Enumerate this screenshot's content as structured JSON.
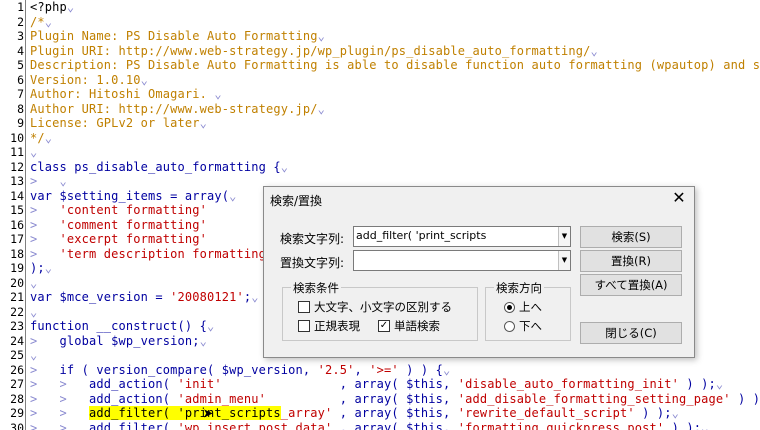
{
  "editor": {
    "lines": [
      {
        "n": "1",
        "segs": [
          {
            "t": "<?php",
            "c": ""
          },
          {
            "t": "⌄",
            "c": "mark"
          }
        ]
      },
      {
        "n": "2",
        "segs": [
          {
            "t": "/*",
            "c": "cmt"
          },
          {
            "t": "⌄",
            "c": "mark"
          }
        ]
      },
      {
        "n": "3",
        "segs": [
          {
            "t": "Plugin Name: PS Disable Auto Formatting",
            "c": "cmt"
          },
          {
            "t": "⌄",
            "c": "mark"
          }
        ]
      },
      {
        "n": "4",
        "segs": [
          {
            "t": "Plugin URI: http://www.web-strategy.jp/wp_plugin/ps_disable_auto_formatting/",
            "c": "cmt"
          },
          {
            "t": "⌄",
            "c": "mark"
          }
        ]
      },
      {
        "n": "5",
        "segs": [
          {
            "t": "Description: PS Disable Auto Formatting is able to disable function auto formatting (wpautop) and save &",
            "c": "cmt"
          }
        ]
      },
      {
        "n": "6",
        "segs": [
          {
            "t": "Version: 1.0.10",
            "c": "cmt"
          },
          {
            "t": "⌄",
            "c": "mark"
          }
        ]
      },
      {
        "n": "7",
        "segs": [
          {
            "t": "Author: Hitoshi Omagari.",
            "c": "cmt"
          },
          {
            "t": " ⌄",
            "c": "mark"
          }
        ]
      },
      {
        "n": "8",
        "segs": [
          {
            "t": "Author URI: http://www.web-strategy.jp/",
            "c": "cmt"
          },
          {
            "t": "⌄",
            "c": "mark"
          }
        ]
      },
      {
        "n": "9",
        "segs": [
          {
            "t": "License: GPLv2 or later",
            "c": "cmt"
          },
          {
            "t": "⌄",
            "c": "mark"
          }
        ]
      },
      {
        "n": "10",
        "segs": [
          {
            "t": "*/",
            "c": "cmt"
          },
          {
            "t": "⌄",
            "c": "mark"
          }
        ]
      },
      {
        "n": "11",
        "segs": [
          {
            "t": "⌄",
            "c": "mark"
          }
        ]
      },
      {
        "n": "12",
        "segs": [
          {
            "t": "class",
            "c": "kw"
          },
          {
            "t": " ps_disable_auto_formatting {",
            "c": "kw"
          },
          {
            "t": "⌄",
            "c": "mark"
          }
        ]
      },
      {
        "n": "13",
        "segs": [
          {
            "t": ">   ⌄",
            "c": "mark"
          }
        ]
      },
      {
        "n": "14",
        "segs": [
          {
            "t": "var",
            "c": "kw"
          },
          {
            "t": " $setting_items = ",
            "c": "kw"
          },
          {
            "t": "array(",
            "c": "kw"
          },
          {
            "t": "⌄",
            "c": "mark"
          }
        ]
      },
      {
        "n": "15",
        "segs": [
          {
            "t": ">   ",
            "c": "mark"
          },
          {
            "t": "'content formatting'",
            "c": "str"
          }
        ]
      },
      {
        "n": "16",
        "segs": [
          {
            "t": ">   ",
            "c": "mark"
          },
          {
            "t": "'comment formatting'",
            "c": "str"
          }
        ]
      },
      {
        "n": "17",
        "segs": [
          {
            "t": ">   ",
            "c": "mark"
          },
          {
            "t": "'excerpt formatting'",
            "c": "str"
          }
        ]
      },
      {
        "n": "18",
        "segs": [
          {
            "t": ">   ",
            "c": "mark"
          },
          {
            "t": "'term description formatting'",
            "c": "str"
          }
        ]
      },
      {
        "n": "19",
        "segs": [
          {
            "t": ");",
            "c": "kw"
          },
          {
            "t": "⌄",
            "c": "mark"
          }
        ]
      },
      {
        "n": "20",
        "segs": [
          {
            "t": "⌄",
            "c": "mark"
          }
        ]
      },
      {
        "n": "21",
        "segs": [
          {
            "t": "var",
            "c": "kw"
          },
          {
            "t": " $mce_version = ",
            "c": "kw"
          },
          {
            "t": "'20080121'",
            "c": "str"
          },
          {
            "t": ";",
            "c": "kw"
          },
          {
            "t": "⌄",
            "c": "mark"
          }
        ]
      },
      {
        "n": "22",
        "segs": [
          {
            "t": "⌄",
            "c": "mark"
          }
        ]
      },
      {
        "n": "23",
        "segs": [
          {
            "t": "function",
            "c": "kw"
          },
          {
            "t": " __construct() {",
            "c": "kw"
          },
          {
            "t": "⌄",
            "c": "mark"
          }
        ]
      },
      {
        "n": "24",
        "segs": [
          {
            "t": ">   ",
            "c": "mark"
          },
          {
            "t": "global",
            "c": "kw"
          },
          {
            "t": " $wp_version;",
            "c": "kw"
          },
          {
            "t": "⌄",
            "c": "mark"
          }
        ]
      },
      {
        "n": "25",
        "segs": [
          {
            "t": "⌄",
            "c": "mark"
          }
        ]
      },
      {
        "n": "26",
        "segs": [
          {
            "t": ">   ",
            "c": "mark"
          },
          {
            "t": "if ( version_compare( $wp_version, ",
            "c": "kw"
          },
          {
            "t": "'2.5'",
            "c": "str"
          },
          {
            "t": ", ",
            "c": "kw"
          },
          {
            "t": "'>='",
            "c": "str"
          },
          {
            "t": " ) ) {",
            "c": "kw"
          },
          {
            "t": "⌄",
            "c": "mark"
          }
        ]
      },
      {
        "n": "27",
        "segs": [
          {
            "t": ">   >   ",
            "c": "mark"
          },
          {
            "t": "add_action( ",
            "c": "kw"
          },
          {
            "t": "'init'",
            "c": "str"
          },
          {
            "t": "                , array( $this, ",
            "c": "kw"
          },
          {
            "t": "'disable_auto_formatting_init'",
            "c": "str"
          },
          {
            "t": " ) );",
            "c": "kw"
          },
          {
            "t": "⌄",
            "c": "mark"
          }
        ]
      },
      {
        "n": "28",
        "segs": [
          {
            "t": ">   >   ",
            "c": "mark"
          },
          {
            "t": "add_action( ",
            "c": "kw"
          },
          {
            "t": "'admin_menu'",
            "c": "str"
          },
          {
            "t": "          , array( $this, ",
            "c": "kw"
          },
          {
            "t": "'add_disable_formatting_setting_page'",
            "c": "str"
          },
          {
            "t": " ) );",
            "c": "kw"
          },
          {
            "t": "⌄",
            "c": "mark"
          }
        ]
      },
      {
        "n": "29",
        "segs": [
          {
            "t": ">   >   ",
            "c": "mark"
          },
          {
            "t": "add_filter( 'print_scripts",
            "c": "hl"
          },
          {
            "t": "_array'",
            "c": "str"
          },
          {
            "t": " , array( $this, ",
            "c": "kw"
          },
          {
            "t": "'rewrite_default_script'",
            "c": "str"
          },
          {
            "t": " ) );",
            "c": "kw"
          },
          {
            "t": "⌄",
            "c": "mark"
          }
        ]
      },
      {
        "n": "30",
        "segs": [
          {
            "t": ">   >   ",
            "c": "mark"
          },
          {
            "t": "add_filter( ",
            "c": "kw"
          },
          {
            "t": "'wp_insert_post_data'",
            "c": "str"
          },
          {
            "t": " , array( $this, ",
            "c": "kw"
          },
          {
            "t": "'formatting_quickpress_post'",
            "c": "str"
          },
          {
            "t": " ) );",
            "c": "kw"
          },
          {
            "t": "⌄",
            "c": "mark"
          }
        ]
      }
    ]
  },
  "dialog": {
    "title": "検索/置換",
    "close": "✕",
    "search_label": "検索文字列:",
    "search_value": "add_filter( 'print_scripts",
    "replace_label": "置換文字列:",
    "replace_value": "",
    "conditions_title": "検索条件",
    "opt_case": "大文字、小文字の区別する",
    "opt_regex": "正規表現",
    "opt_word": "単語検索",
    "direction_title": "検索方向",
    "dir_up": "上へ",
    "dir_down": "下へ",
    "btn_search": "検索(S)",
    "btn_replace": "置換(R)",
    "btn_replace_all": "すべて置換(A)",
    "btn_close": "閉じる(C)",
    "checked_mark": "✓"
  }
}
